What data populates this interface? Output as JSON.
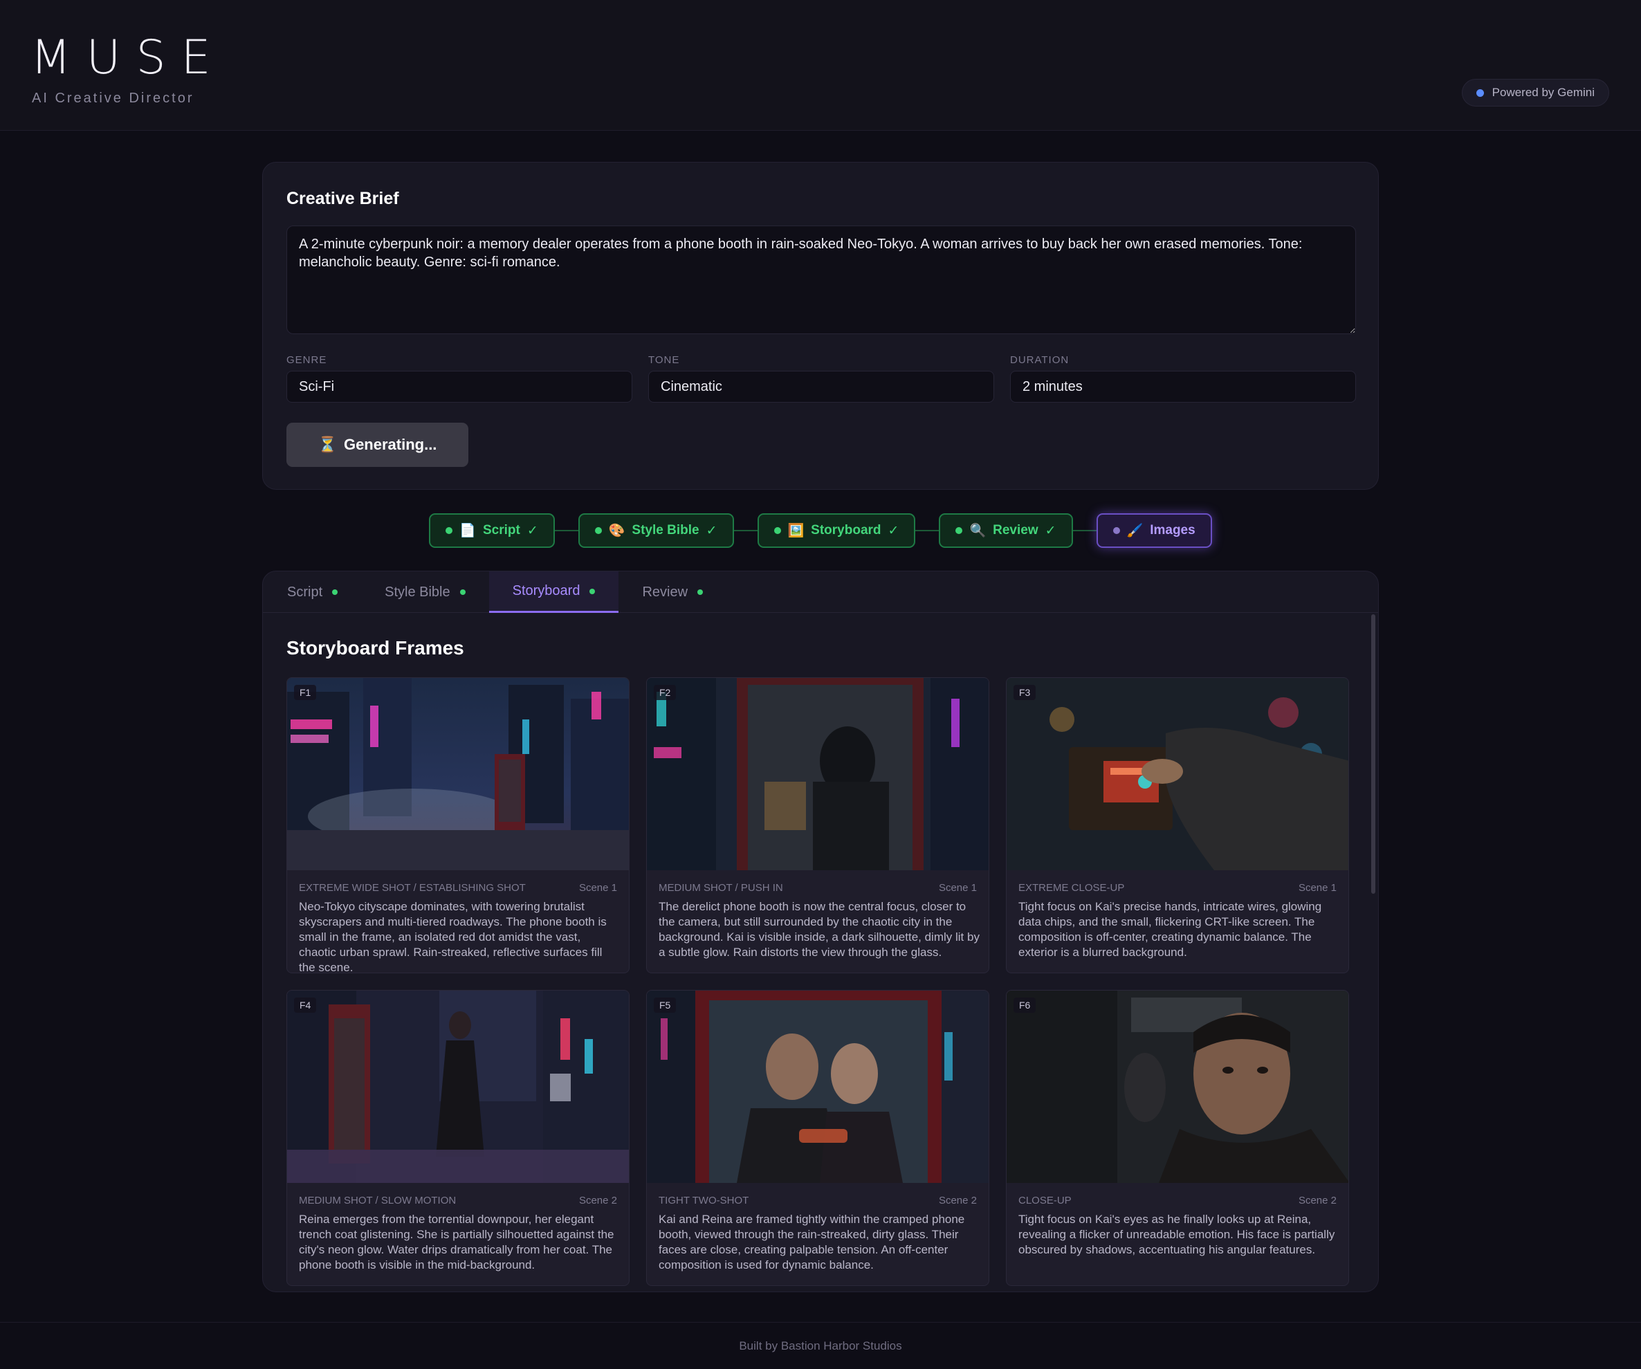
{
  "app": {
    "logo": "MUSE",
    "subtitle": "AI Creative Director",
    "powered_by": "Powered by Gemini"
  },
  "brief": {
    "title": "Creative Brief",
    "text": "A 2-minute cyberpunk noir: a memory dealer operates from a phone booth in rain-soaked Neo-Tokyo. A woman arrives to buy back her own erased memories. Tone: melancholic beauty. Genre: sci-fi romance.",
    "genre_label": "GENRE",
    "genre_value": "Sci-Fi",
    "tone_label": "TONE",
    "tone_value": "Cinematic",
    "duration_label": "DURATION",
    "duration_value": "2 minutes",
    "generate_label": "Generating...",
    "generate_icon": "⏳"
  },
  "pipeline": [
    {
      "icon": "📄",
      "label": "Script",
      "check": "✓",
      "status": "done"
    },
    {
      "icon": "🎨",
      "label": "Style Bible",
      "check": "✓",
      "status": "done"
    },
    {
      "icon": "🖼️",
      "label": "Storyboard",
      "check": "✓",
      "status": "done"
    },
    {
      "icon": "🔍",
      "label": "Review",
      "check": "✓",
      "status": "done"
    },
    {
      "icon": "🖌️",
      "label": "Images",
      "check": "",
      "status": "active"
    }
  ],
  "tabs": [
    {
      "label": "Script",
      "active": false
    },
    {
      "label": "Style Bible",
      "active": false
    },
    {
      "label": "Storyboard",
      "active": true
    },
    {
      "label": "Review",
      "active": false
    }
  ],
  "storyboard": {
    "title": "Storyboard Frames",
    "frames": [
      {
        "id": "F1",
        "shot": "EXTREME WIDE SHOT / ESTABLISHING SHOT",
        "scene": "Scene 1",
        "description": "Neo-Tokyo cityscape dominates, with towering brutalist skyscrapers and multi-tiered roadways. The phone booth is small in the frame, an isolated red dot amidst the vast, chaotic urban sprawl. Rain-streaked, reflective surfaces fill the scene."
      },
      {
        "id": "F2",
        "shot": "MEDIUM SHOT / PUSH IN",
        "scene": "Scene 1",
        "description": "The derelict phone booth is now the central focus, closer to the camera, but still surrounded by the chaotic city in the background. Kai is visible inside, a dark silhouette, dimly lit by a subtle glow. Rain distorts the view through the glass."
      },
      {
        "id": "F3",
        "shot": "EXTREME CLOSE-UP",
        "scene": "Scene 1",
        "description": "Tight focus on Kai's precise hands, intricate wires, glowing data chips, and the small, flickering CRT-like screen. The composition is off-center, creating dynamic balance. The exterior is a blurred background."
      },
      {
        "id": "F4",
        "shot": "MEDIUM SHOT / SLOW MOTION",
        "scene": "Scene 2",
        "description": "Reina emerges from the torrential downpour, her elegant trench coat glistening. She is partially silhouetted against the city's neon glow. Water drips dramatically from her coat. The phone booth is visible in the mid-background."
      },
      {
        "id": "F5",
        "shot": "TIGHT TWO-SHOT",
        "scene": "Scene 2",
        "description": "Kai and Reina are framed tightly within the cramped phone booth, viewed through the rain-streaked, dirty glass. Their faces are close, creating palpable tension. An off-center composition is used for dynamic balance."
      },
      {
        "id": "F6",
        "shot": "CLOSE-UP",
        "scene": "Scene 2",
        "description": "Tight focus on Kai's eyes as he finally looks up at Reina, revealing a flicker of unreadable emotion. His face is partially obscured by shadows, accentuating his angular features."
      }
    ]
  },
  "footer": {
    "text": "Built by Bastion Harbor Studios"
  }
}
